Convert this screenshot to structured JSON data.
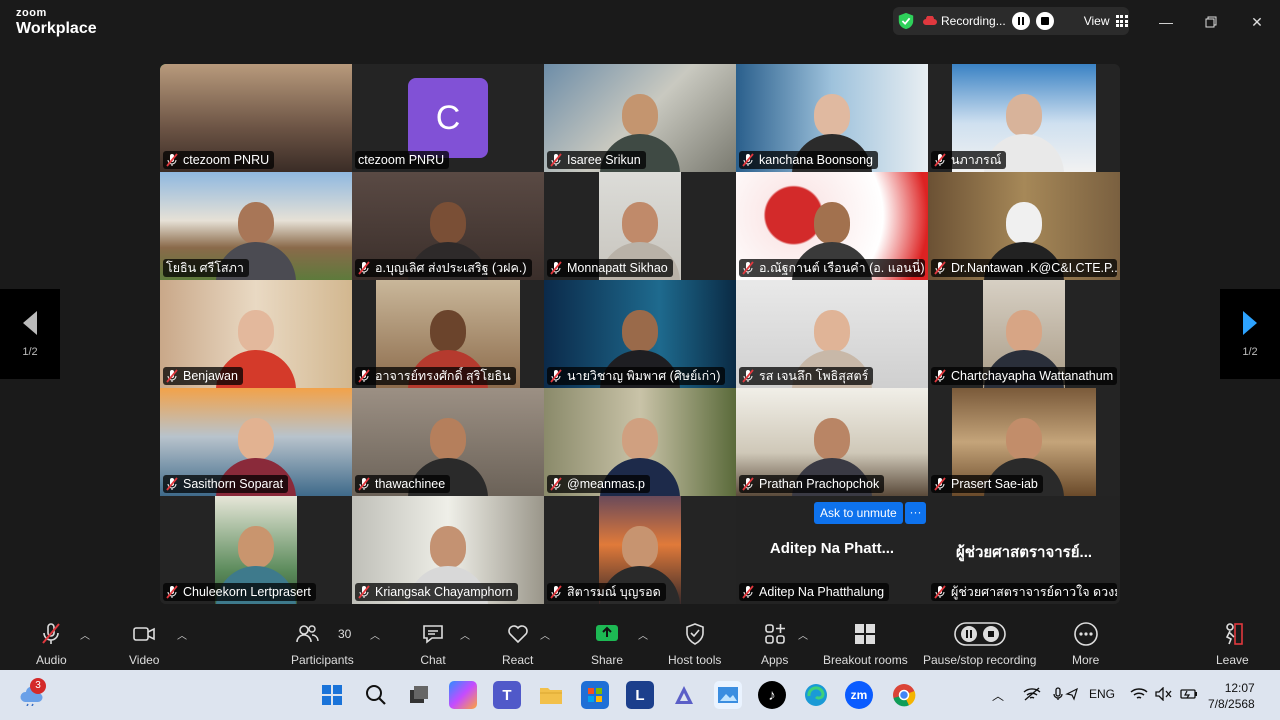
{
  "app": {
    "brand_line1": "zoom",
    "brand_line2": "Workplace"
  },
  "recording": {
    "label": "Recording...",
    "view_label": "View"
  },
  "gallery": {
    "page_left": "1/2",
    "page_right": "1/2",
    "ask_to_unmute": "Ask to unmute",
    "more_options": "···",
    "tiles": [
      {
        "name": "ctezoom PNRU"
      },
      {
        "name": "ctezoom PNRU",
        "avatar_letter": "C"
      },
      {
        "name": "Isaree Srikun"
      },
      {
        "name": "kanchana Boonsong"
      },
      {
        "name": "นภาภรณ์"
      },
      {
        "name": "โยธิน ศรีโสภา"
      },
      {
        "name": "อ.บุญเลิศ ส่งประเสริฐ (วฝค.)"
      },
      {
        "name": "Monnapatt Sikhao"
      },
      {
        "name": "อ.ณัฐกานต์ เรือนคำ (อ. แอนนี่)"
      },
      {
        "name": "Dr.Nantawan .K@C&I.CTE.P..."
      },
      {
        "name": "Benjawan"
      },
      {
        "name": "อาจารย์ทรงศักดิ์ สุริโยธิน"
      },
      {
        "name": "นายวิชาญ พิมพาศ (ศิษย์เก่า)"
      },
      {
        "name": "รส เจนลึก โพธิสุสตร์"
      },
      {
        "name": "Chartchayapha Wattanathum"
      },
      {
        "name": "Sasithorn Soparat"
      },
      {
        "name": "thawachinee"
      },
      {
        "name": "@meanmas.p"
      },
      {
        "name": "Prathan Prachopchok"
      },
      {
        "name": "Prasert Sae-iab"
      },
      {
        "name": "Chuleekorn Lertprasert"
      },
      {
        "name": "Kriangsak Chayamphorn"
      },
      {
        "name": "สิตารมณ์ บุญรอด"
      },
      {
        "name": "Aditep Na Phatthalung",
        "display_big": "Aditep Na Phatt..."
      },
      {
        "name": "ผู้ช่วยศาสตราจารย์ดาวใจ  ดวงมณี",
        "display_big": "ผู้ช่วยศาสตราจารย์..."
      }
    ]
  },
  "toolbar": {
    "audio": "Audio",
    "video": "Video",
    "participants": "Participants",
    "participants_count": "30",
    "chat": "Chat",
    "react": "React",
    "share": "Share",
    "host_tools": "Host tools",
    "apps": "Apps",
    "breakout": "Breakout rooms",
    "pause_stop": "Pause/stop recording",
    "more": "More",
    "leave": "Leave"
  },
  "taskbar": {
    "weather_badge": "3",
    "lang": "ENG",
    "time": "12:07",
    "date": "7/8/2568"
  },
  "colors": {
    "accent_blue": "#0e72ed",
    "share_green": "#1db954",
    "active_speaker": "#2ed15a",
    "leave_red": "#e0383e"
  }
}
